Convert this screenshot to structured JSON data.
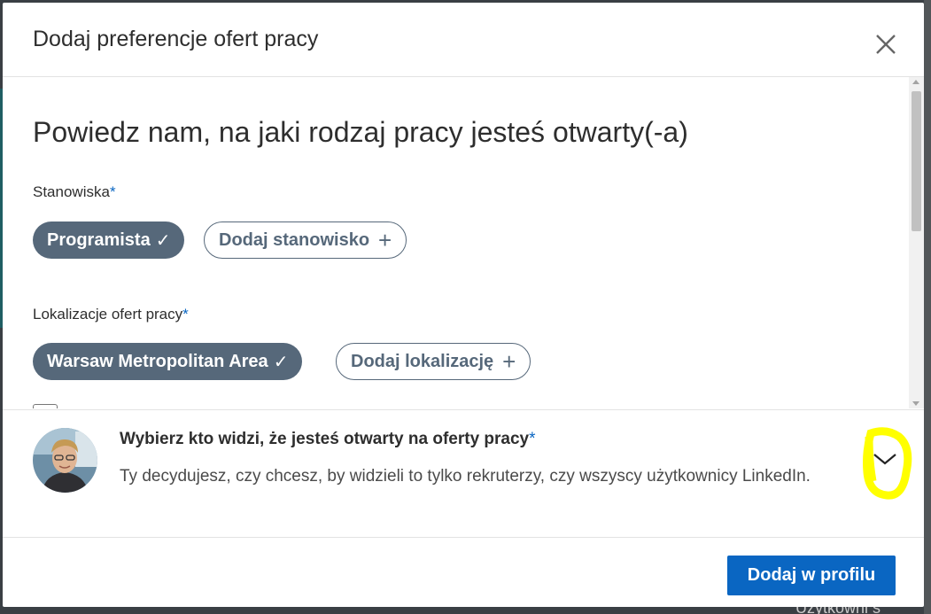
{
  "background": {
    "peek_text": "Użytkowni s"
  },
  "modal": {
    "title": "Dodaj preferencje ofert pracy",
    "heading": "Powiedz nam, na jaki rodzaj pracy jesteś otwarty(-a)"
  },
  "job_titles": {
    "label": "Stanowiska",
    "required_mark": "*",
    "selected": "Programista",
    "add_label": "Dodaj stanowisko"
  },
  "locations": {
    "label": "Lokalizacje ofert pracy",
    "required_mark": "*",
    "selected": "Warsaw Metropolitan Area",
    "add_label": "Dodaj lokalizację"
  },
  "visibility": {
    "title": "Wybierz kto widzi, że jesteś otwarty na oferty pracy",
    "required_mark": "*",
    "description": "Ty decydujesz, czy chcesz, by widzieli to tylko rekruterzy, czy wszyscy użytkownicy LinkedIn."
  },
  "footer": {
    "submit_label": "Dodaj w profilu"
  },
  "icons": {
    "close": "close-icon",
    "check": "check-icon",
    "plus": "plus-icon",
    "chevron": "chevron-down-icon"
  },
  "colors": {
    "accent": "#0a66c2",
    "pill_selected": "#56687a",
    "highlight": "#ffff00"
  }
}
